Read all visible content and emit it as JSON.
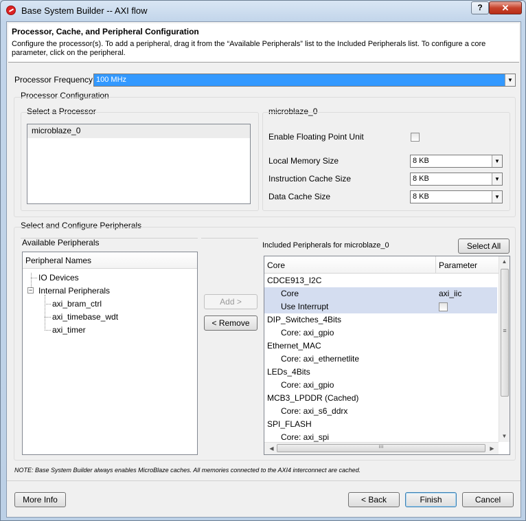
{
  "window": {
    "title": "Base System Builder -- AXI flow",
    "help_label": "?",
    "close_label": "✕"
  },
  "header": {
    "title": "Processor, Cache, and Peripheral Configuration",
    "description": "Configure the processor(s). To add a peripheral, drag it from the “Available Peripherals” list to the Included Peripherals list. To configure a core parameter, click on the peripheral."
  },
  "processor_frequency": {
    "label": "Processor Frequency",
    "value": "100 MHz"
  },
  "processor_configuration": {
    "group_label": "Processor Configuration",
    "select_label": "Select a Processor",
    "processors": [
      "microblaze_0"
    ],
    "selected_title": "microblaze_0",
    "fpu_label": "Enable Floating Point Unit",
    "fpu_checked": false,
    "local_memory_label": "Local Memory Size",
    "local_memory_value": "8 KB",
    "icache_label": "Instruction Cache Size",
    "icache_value": "8 KB",
    "dcache_label": "Data Cache Size",
    "dcache_value": "8 KB"
  },
  "peripherals": {
    "group_label": "Select and Configure Peripherals",
    "available_label": "Available Peripherals",
    "tree_header": "Peripheral Names",
    "tree": {
      "io_devices": "IO Devices",
      "internal": "Internal Peripherals",
      "internal_expander": "−",
      "internal_children": [
        "axi_bram_ctrl",
        "axi_timebase_wdt",
        "axi_timer"
      ]
    },
    "add_label": "Add >",
    "remove_label": "< Remove",
    "included_label": "Included Peripherals for microblaze_0",
    "select_all_label": "Select All",
    "table_headers": {
      "core": "Core",
      "parameter": "Parameter"
    },
    "table_rows": [
      {
        "core": "CDCE913_I2C",
        "parameter": "",
        "indent": false,
        "selected": false,
        "checkbox": false
      },
      {
        "core": "Core",
        "parameter": "axi_iic",
        "indent": true,
        "selected": true,
        "checkbox": false
      },
      {
        "core": "Use Interrupt",
        "parameter": "",
        "indent": true,
        "selected": true,
        "checkbox": true
      },
      {
        "core": "DIP_Switches_4Bits",
        "parameter": "",
        "indent": false,
        "selected": false,
        "checkbox": false
      },
      {
        "core": "Core: axi_gpio",
        "parameter": "",
        "indent": true,
        "selected": false,
        "checkbox": false
      },
      {
        "core": "Ethernet_MAC",
        "parameter": "",
        "indent": false,
        "selected": false,
        "checkbox": false
      },
      {
        "core": "Core: axi_ethernetlite",
        "parameter": "",
        "indent": true,
        "selected": false,
        "checkbox": false
      },
      {
        "core": "LEDs_4Bits",
        "parameter": "",
        "indent": false,
        "selected": false,
        "checkbox": false
      },
      {
        "core": "Core: axi_gpio",
        "parameter": "",
        "indent": true,
        "selected": false,
        "checkbox": false
      },
      {
        "core": "MCB3_LPDDR (Cached)",
        "parameter": "",
        "indent": false,
        "selected": false,
        "checkbox": false
      },
      {
        "core": "Core: axi_s6_ddrx",
        "parameter": "",
        "indent": true,
        "selected": false,
        "checkbox": false
      },
      {
        "core": "SPI_FLASH",
        "parameter": "",
        "indent": false,
        "selected": false,
        "checkbox": false
      },
      {
        "core": "Core: axi_spi",
        "parameter": "",
        "indent": true,
        "selected": false,
        "checkbox": false
      }
    ]
  },
  "note": "NOTE: Base System Builder always enables MicroBlaze caches.  All memories connected to the AXI4 interconnect are cached.",
  "footer": {
    "more_info_label": "More Info",
    "back_label": "< Back",
    "finish_label": "Finish",
    "cancel_label": "Cancel"
  },
  "icons": {
    "dropdown": "▼",
    "scroll_up": "▲",
    "scroll_down": "▼",
    "scroll_left": "◀",
    "scroll_right": "▶",
    "grip": "≡",
    "grip_h": "ııı"
  }
}
